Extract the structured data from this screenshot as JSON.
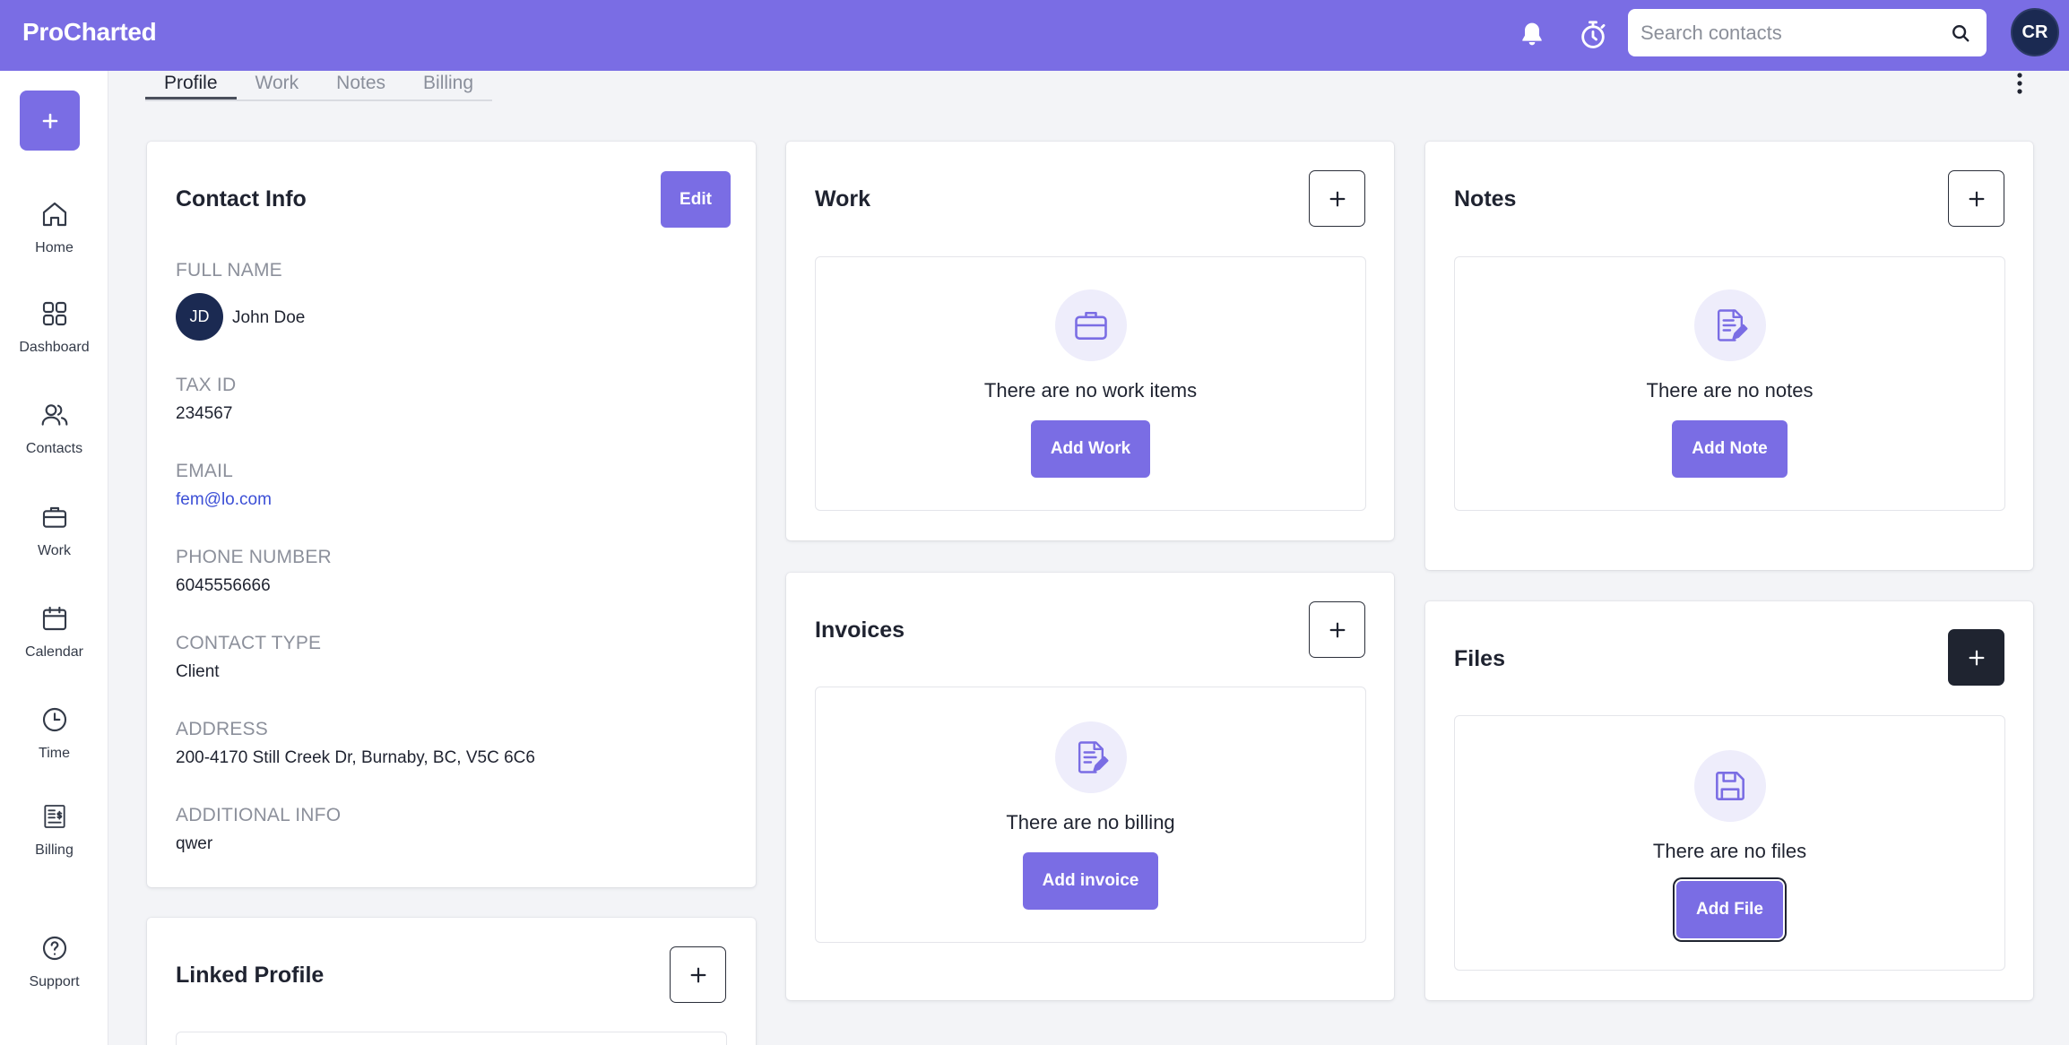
{
  "app": {
    "brand": "ProCharted"
  },
  "header": {
    "search_placeholder": "Search contacts",
    "user_initials": "CR"
  },
  "sidebar": {
    "items": [
      {
        "label": "Home",
        "icon": "home-icon"
      },
      {
        "label": "Dashboard",
        "icon": "dashboard-icon"
      },
      {
        "label": "Contacts",
        "icon": "contacts-icon"
      },
      {
        "label": "Work",
        "icon": "briefcase-icon"
      },
      {
        "label": "Calendar",
        "icon": "calendar-icon"
      },
      {
        "label": "Time",
        "icon": "clock-icon"
      },
      {
        "label": "Billing",
        "icon": "billing-icon"
      },
      {
        "label": "Support",
        "icon": "help-icon"
      }
    ]
  },
  "tabs": [
    {
      "label": "Profile",
      "active": true
    },
    {
      "label": "Work",
      "active": false
    },
    {
      "label": "Notes",
      "active": false
    },
    {
      "label": "Billing",
      "active": false
    }
  ],
  "contact_info": {
    "title": "Contact Info",
    "edit_label": "Edit",
    "fields": {
      "full_name_label": "FULL NAME",
      "full_name": "John Doe",
      "initials": "JD",
      "tax_id_label": "TAX ID",
      "tax_id": "234567",
      "email_label": "EMAIL",
      "email": "fem@lo.com",
      "phone_label": "PHONE NUMBER",
      "phone": "6045556666",
      "contact_type_label": "CONTACT TYPE",
      "contact_type": "Client",
      "address_label": "ADDRESS",
      "address": "200-4170 Still Creek Dr, Burnaby, BC, V5C 6C6",
      "additional_info_label": "ADDITIONAL INFO",
      "additional_info": "qwer"
    }
  },
  "linked_profile": {
    "title": "Linked Profile"
  },
  "work": {
    "title": "Work",
    "empty_text": "There are no work items",
    "button": "Add Work"
  },
  "notes": {
    "title": "Notes",
    "empty_text": "There are no notes",
    "button": "Add Note"
  },
  "invoices": {
    "title": "Invoices",
    "empty_text": "There are no billing",
    "button": "Add invoice"
  },
  "files": {
    "title": "Files",
    "empty_text": "There are no files",
    "button": "Add File"
  },
  "colors": {
    "accent": "#7a6de4",
    "dark": "#1f2430",
    "avatar": "#1b2a52",
    "link": "#3c4fd6"
  }
}
